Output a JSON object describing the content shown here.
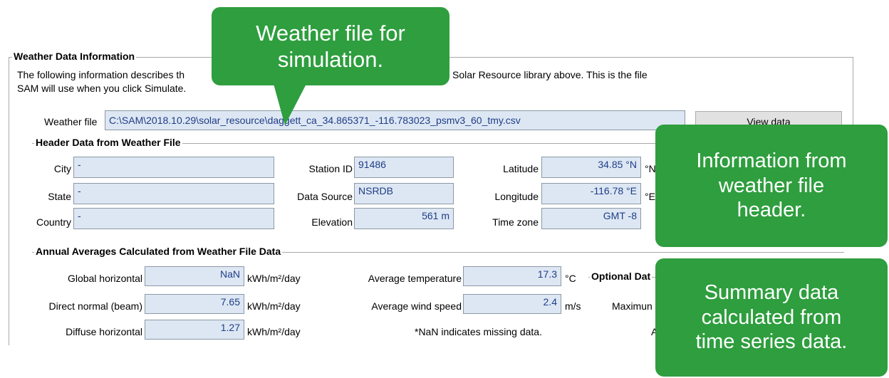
{
  "weather_panel": {
    "group_title": "Weather Data Information",
    "description_line1": "The following information describes th",
    "description_line1_end": "Solar Resource library above. This is the file",
    "description_line2": "SAM will use when you click Simulate.",
    "weather_file_label": "Weather file",
    "weather_file_value": "C:\\SAM\\2018.10.29\\solar_resource\\daggett_ca_34.865371_-116.783023_psmv3_60_tmy.csv",
    "view_data_button": "View data"
  },
  "header_data": {
    "title": "Header Data from Weather File",
    "city_label": "City",
    "city_value": "-",
    "state_label": "State",
    "state_value": "-",
    "country_label": "Country",
    "country_value": "-",
    "station_id_label": "Station ID",
    "station_id_value": "91486",
    "data_source_label": "Data Source",
    "data_source_value": "NSRDB",
    "elevation_label": "Elevation",
    "elevation_value": "561 m",
    "latitude_label": "Latitude",
    "latitude_value": "34.85 °N",
    "latitude_suffix": "°N",
    "longitude_label": "Longitude",
    "longitude_value": "-116.78 °E",
    "longitude_suffix": "°E",
    "timezone_label": "Time zone",
    "timezone_value": "GMT -8"
  },
  "annual_averages": {
    "title": "Annual Averages Calculated from Weather File  Data",
    "global_label": "Global horizontal",
    "global_value": "NaN",
    "global_unit": "kWh/m²/day",
    "direct_label": "Direct normal (beam)",
    "direct_value": "7.65",
    "direct_unit": "kWh/m²/day",
    "diffuse_label": "Diffuse horizontal",
    "diffuse_value": "1.27",
    "diffuse_unit": "kWh/m²/day",
    "avg_temp_label": "Average temperature",
    "avg_temp_value": "17.3",
    "avg_temp_unit": "°C",
    "avg_wind_label": "Average wind speed",
    "avg_wind_value": "2.4",
    "avg_wind_unit": "m/s",
    "nan_note": "*NaN indicates missing data.",
    "optional_title": "Optional Dat",
    "maximum_label": "Maximun",
    "a_label": "A"
  },
  "callouts": {
    "weather_file_line1": "Weather file for",
    "weather_file_line2": "simulation.",
    "header_line1": "Information from",
    "header_line2": "weather file",
    "header_line3": "header.",
    "summary_line1": "Summary data",
    "summary_line2": "calculated from",
    "summary_line3": "time series data."
  },
  "colors": {
    "callout_green": "#2e9e3e",
    "field_bg": "#dde7f3",
    "field_text": "#1f3d87"
  }
}
